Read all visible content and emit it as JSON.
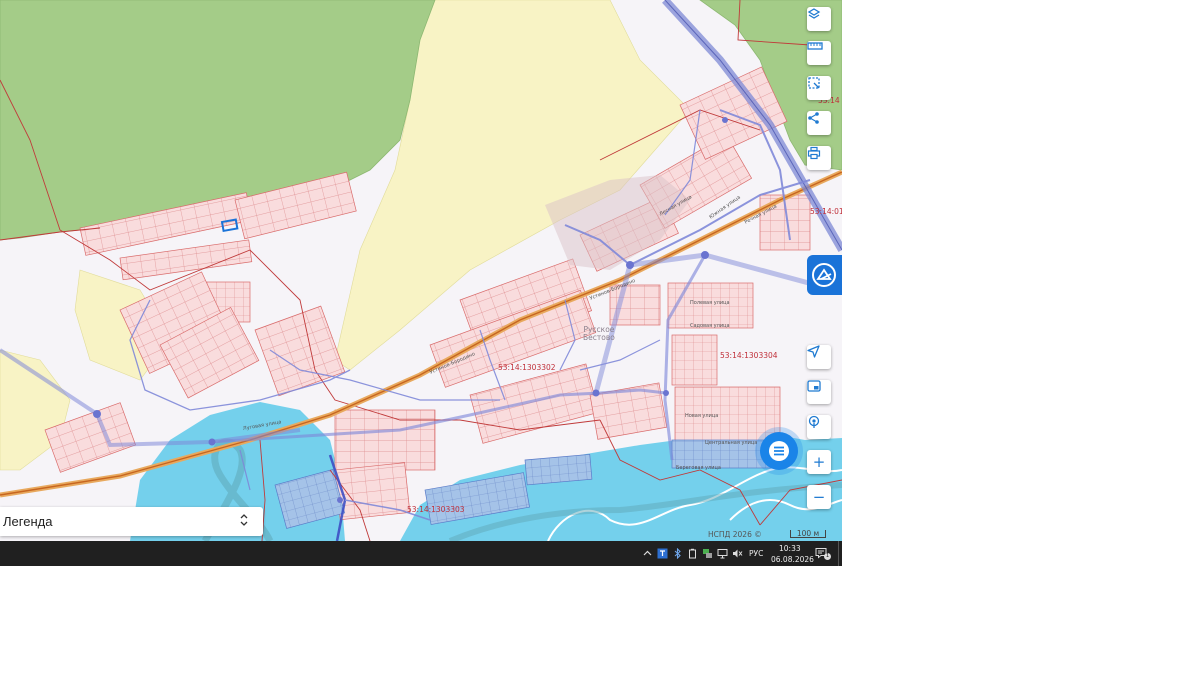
{
  "map": {
    "legend_label": "Легенда",
    "legend_arrow_icon": "chevron-up-down-icon",
    "attribution": "НСПД 2026 ©",
    "scale_label": "100 м",
    "colors": {
      "forest": "#a4cc88",
      "farmland": "#f8f3c5",
      "water": "#74d0ec",
      "parcel_border": "#d96b6b",
      "parcel_fill": "#f8d9da",
      "road": "#e08a3a",
      "utility_line": "#8f98e0",
      "accent": "#1a73d8"
    },
    "labels": {
      "quarter_302": "53:14:1303302",
      "quarter_303": "53:14:1303303",
      "quarter_304": "53:14:1303304",
      "edge_top": "53:14",
      "edge_right": "53:14:01",
      "place_line1": "Русское",
      "place_line2": "Бестово"
    },
    "streets": {
      "main_road": "Устинов-Бородино",
      "main_road_2": "Устинов-Бородино",
      "lesnaya": "Лесная улица",
      "yuzhnaya": "Южная улица",
      "rechnaya": "Речная улица",
      "polevaya": "Полевая улица",
      "sadovaya": "Садовая улица",
      "novaya": "Новая улица",
      "tsentralnaya": "Центральная улица",
      "beregovaya": "Береговая улица",
      "lugovaya": "Луговая улица"
    },
    "controls": {
      "layers_icon": "layers-icon",
      "ruler_icon": "ruler-icon",
      "select_area_icon": "select-area-icon",
      "share_icon": "share-icon",
      "print_icon": "print-icon",
      "nspd_icon": "nspd-logo-icon",
      "locate_icon": "navigation-arrow-icon",
      "pip_icon": "picture-in-picture-icon",
      "pin_icon": "touch-pin-icon",
      "zoom_in_label": "+",
      "zoom_out_label": "−",
      "menu_icon": "menu-list-icon"
    }
  },
  "taskbar": {
    "lang": "РУС",
    "time": "10:33",
    "date": "06.08.2026",
    "notif_count": "1",
    "tray_icons": [
      "chevron-up-icon",
      "app-icon",
      "bluetooth-icon",
      "battery-icon",
      "network-icon",
      "monitor-icon",
      "mute-icon",
      "notification-icon"
    ]
  }
}
